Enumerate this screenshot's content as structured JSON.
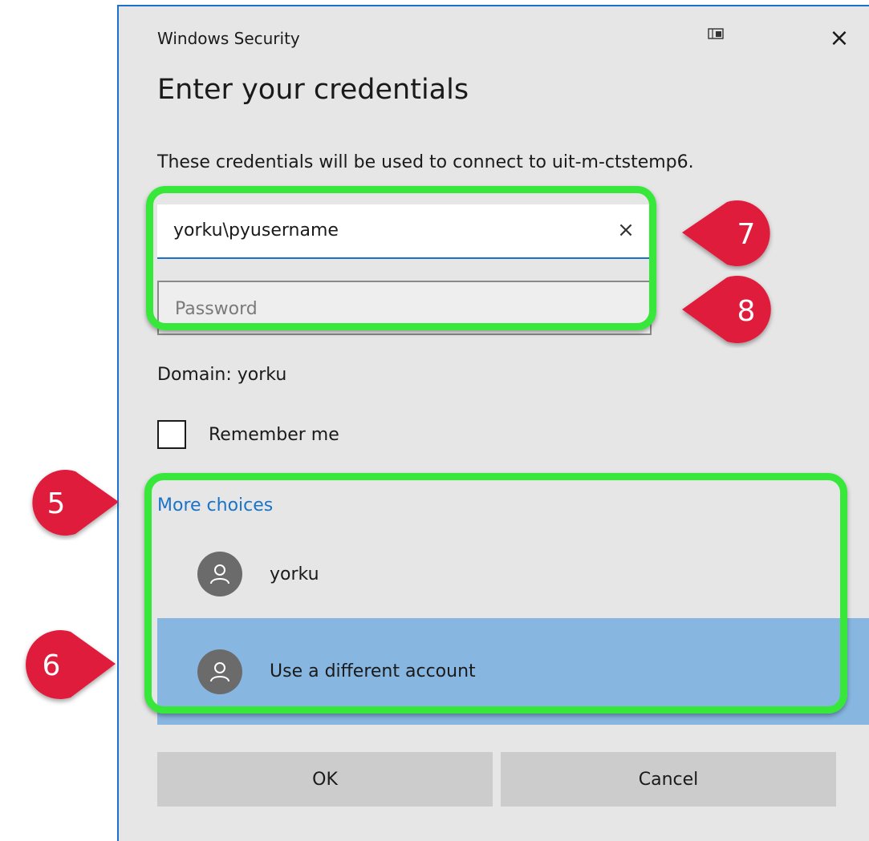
{
  "dialog": {
    "title": "Windows Security",
    "close_glyph": "×",
    "heading": "Enter your credentials",
    "description": "These credentials will be used to connect to uit-m-ctstemp6.",
    "username": {
      "value": "yorku\\pyusername",
      "clear_glyph": "×"
    },
    "password": {
      "placeholder": "Password"
    },
    "domain": "Domain: yorku",
    "remember_label": "Remember me",
    "more_choices": "More choices",
    "accounts": [
      {
        "label": "yorku",
        "selected": false
      },
      {
        "label": "Use a different account",
        "selected": true
      }
    ],
    "ok_label": "OK",
    "cancel_label": "Cancel"
  },
  "annotations": {
    "markers": [
      "7",
      "8",
      "5",
      "6"
    ],
    "highlight_color": "#37e83b",
    "marker_color": "#e01e3c"
  },
  "icons": [
    "restore-icon",
    "close-icon",
    "clear-icon",
    "user-icon"
  ]
}
